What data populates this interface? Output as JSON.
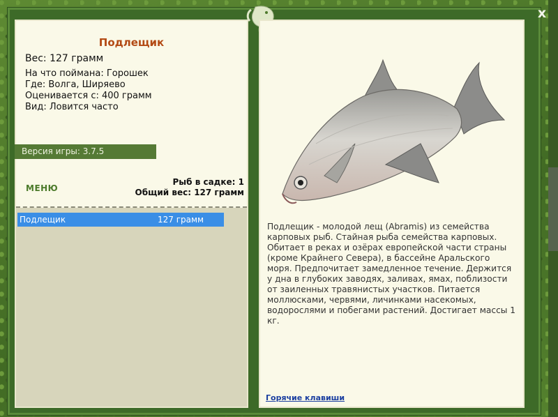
{
  "window": {
    "close_label": "x"
  },
  "fish": {
    "title": "Подлещик",
    "weight_line": "Вес: 127 грамм",
    "caught_on": "На что поймана: Горошек",
    "location": "Где: Волга, Ширяево",
    "valued_from": "Оценивается с: 400 грамм",
    "frequency": "Вид: Ловится часто"
  },
  "version_bar": "Версия игры: 3.7.5",
  "menu_label": "МЕНЮ",
  "stats": {
    "count": "Рыб в садке: 1",
    "total_weight": "Общий вес: 127 грамм"
  },
  "catch_list": [
    {
      "name": "Подлещик",
      "weight": "127 грамм"
    }
  ],
  "description": "Подлещик - молодой лещ (Abramis) из семейства карповых рыб. Стайная рыба семейства карповых. Обитает в реках и озёрах европейской части страны (кроме Крайнего Севера), в бассейне Аральского моря. Предпочитает замедленное течение. Держится у дна в глубоких заводях, заливах, ямах, поблизости от заиленных травянистых участков. Питается моллюсками, червями, личинками насекомых, водорослями и побегами растений. Достигает массы 1 кг.",
  "hotkeys_label": "Горячие клавиши",
  "icons": {
    "close": "close-icon",
    "logo": "fish-logo-icon",
    "fish_image": "bream-fish-image"
  },
  "colors": {
    "title": "#b34a14",
    "selected_row": "#3a8ee6",
    "version_bar": "#557a35",
    "menu": "#4b7a2a"
  }
}
